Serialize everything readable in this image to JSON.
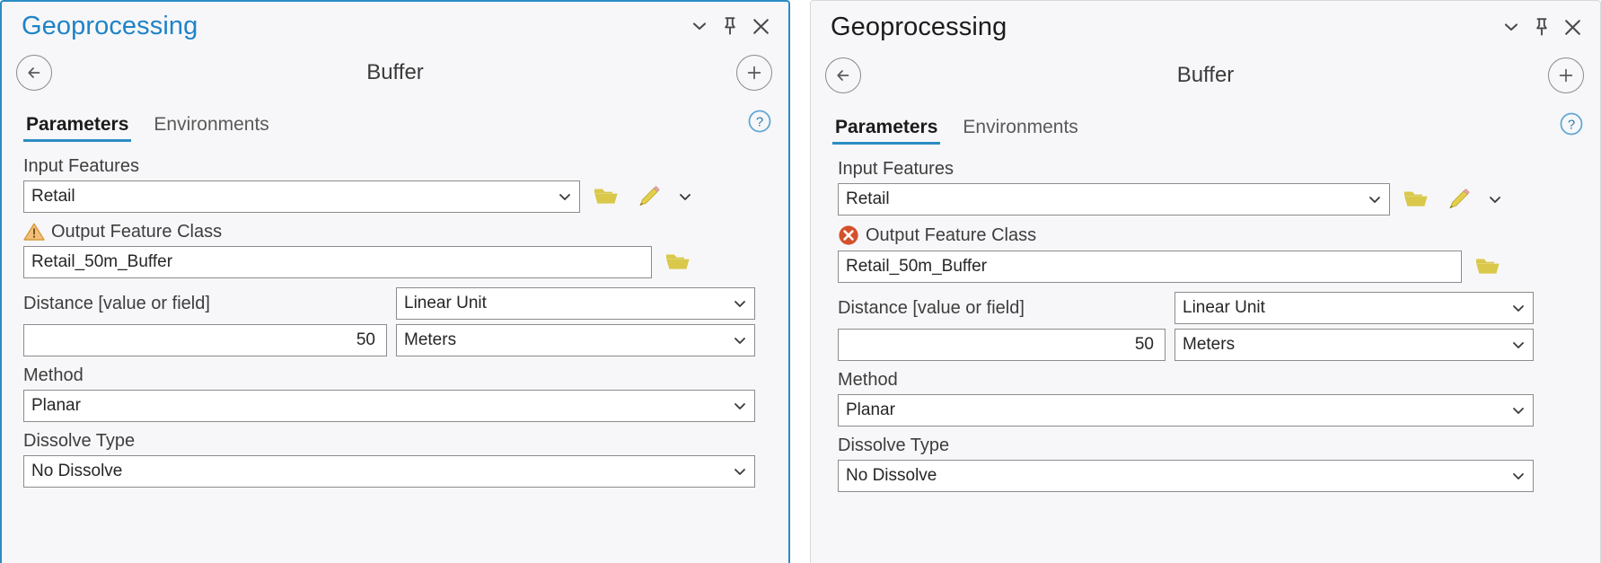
{
  "panels": [
    {
      "id": "left",
      "title": "Geoprocessing",
      "active": true,
      "titlebar_buttons": [
        {
          "name": "chevron-down-icon",
          "label": "Collapse"
        },
        {
          "name": "pin-icon",
          "label": "Auto Hide"
        },
        {
          "name": "close-icon",
          "label": "Close"
        }
      ],
      "tool": {
        "back_label": "Back",
        "title": "Buffer",
        "add_label": "Add to favorites"
      },
      "tabs": [
        {
          "label": "Parameters",
          "active": true
        },
        {
          "label": "Environments",
          "active": false
        }
      ],
      "help_label": "Help",
      "fields": {
        "input_features": {
          "label": "Input Features",
          "value": "Retail",
          "status": "none"
        },
        "output_feature_class": {
          "label": "Output Feature Class",
          "value": "Retail_50m_Buffer",
          "status": "warning"
        },
        "distance": {
          "label": "Distance [value or field]",
          "value": "50",
          "unit_type": "Linear Unit",
          "unit": "Meters"
        },
        "method": {
          "label": "Method",
          "value": "Planar"
        },
        "dissolve_type": {
          "label": "Dissolve Type",
          "value": "No Dissolve"
        }
      }
    },
    {
      "id": "right",
      "title": "Geoprocessing",
      "active": false,
      "titlebar_buttons": [
        {
          "name": "chevron-down-icon",
          "label": "Collapse"
        },
        {
          "name": "pin-icon",
          "label": "Auto Hide"
        },
        {
          "name": "close-icon",
          "label": "Close"
        }
      ],
      "tool": {
        "back_label": "Back",
        "title": "Buffer",
        "add_label": "Add to favorites"
      },
      "tabs": [
        {
          "label": "Parameters",
          "active": true
        },
        {
          "label": "Environments",
          "active": false
        }
      ],
      "help_label": "Help",
      "fields": {
        "input_features": {
          "label": "Input Features",
          "value": "Retail",
          "status": "none"
        },
        "output_feature_class": {
          "label": "Output Feature Class",
          "value": "Retail_50m_Buffer",
          "status": "error"
        },
        "distance": {
          "label": "Distance [value or field]",
          "value": "50",
          "unit_type": "Linear Unit",
          "unit": "Meters"
        },
        "method": {
          "label": "Method",
          "value": "Planar"
        },
        "dissolve_type": {
          "label": "Dissolve Type",
          "value": "No Dissolve"
        }
      }
    }
  ],
  "colors": {
    "accent_blue": "#2b8cc4",
    "title_blue": "#1f83c6",
    "warning_orange": "#e8a33d",
    "error_red": "#d4502a",
    "folder_yellow": "#d9c84a",
    "pencil_yellow": "#e4cf4b",
    "panel_bg": "#f7f7f9",
    "field_border": "#8c8c8c"
  }
}
